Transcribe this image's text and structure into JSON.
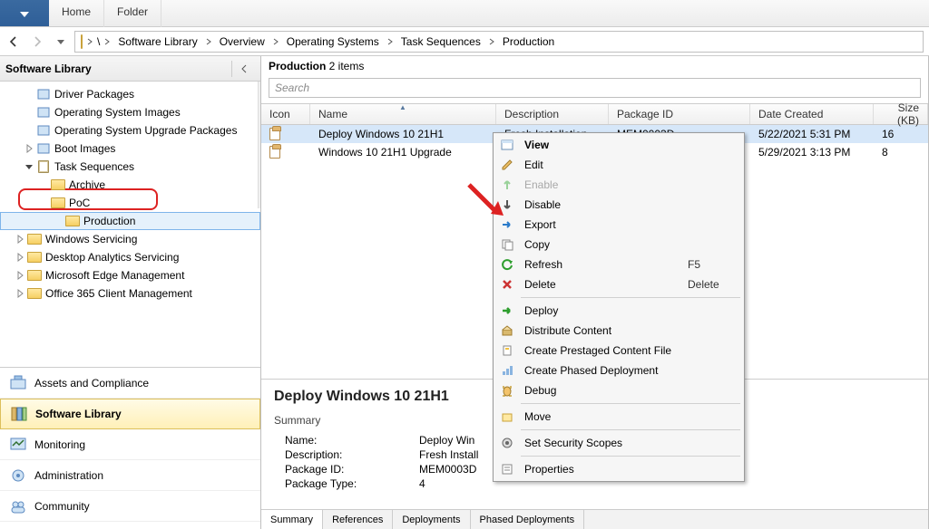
{
  "ribbon": {
    "tabs": [
      "Home",
      "Folder"
    ]
  },
  "breadcrumb": {
    "items": [
      "Software Library",
      "Overview",
      "Operating Systems",
      "Task Sequences",
      "Production"
    ]
  },
  "sidebar": {
    "title": "Software Library",
    "nodes": [
      {
        "label": "Driver Packages",
        "icon": "driver-pkg-icon",
        "indent": 0,
        "exp": ""
      },
      {
        "label": "Operating System Images",
        "icon": "os-image-icon",
        "indent": 0,
        "exp": ""
      },
      {
        "label": "Operating System Upgrade Packages",
        "icon": "os-upg-pkg-icon",
        "indent": 0,
        "exp": ""
      },
      {
        "label": "Boot Images",
        "icon": "boot-image-icon",
        "indent": 0,
        "exp": "closed"
      },
      {
        "label": "Task Sequences",
        "icon": "task-seq-icon",
        "indent": 0,
        "exp": "open"
      },
      {
        "label": "Archive",
        "icon": "folder-icon",
        "indent": 1,
        "exp": ""
      },
      {
        "label": "PoC",
        "icon": "folder-icon",
        "indent": 1,
        "exp": ""
      },
      {
        "label": "Production",
        "icon": "folder-icon",
        "indent": 1,
        "exp": "",
        "selected": true
      },
      {
        "label": "Windows Servicing",
        "icon": "folder-icon",
        "indent": 0,
        "exp": "closed",
        "root": true
      },
      {
        "label": "Desktop Analytics Servicing",
        "icon": "folder-icon",
        "indent": 0,
        "exp": "closed",
        "root": true
      },
      {
        "label": "Microsoft Edge Management",
        "icon": "folder-icon",
        "indent": 0,
        "exp": "closed",
        "root": true
      },
      {
        "label": "Office 365 Client Management",
        "icon": "folder-icon",
        "indent": 0,
        "exp": "closed",
        "root": true
      }
    ],
    "workspaces": [
      {
        "label": "Assets and Compliance",
        "icon": "assets-icon"
      },
      {
        "label": "Software Library",
        "icon": "library-icon",
        "selected": true,
        "bold": true
      },
      {
        "label": "Monitoring",
        "icon": "monitoring-icon"
      },
      {
        "label": "Administration",
        "icon": "admin-icon"
      },
      {
        "label": "Community",
        "icon": "community-icon"
      }
    ]
  },
  "results": {
    "title_prefix": "Production",
    "count_suffix": "2 items",
    "search_placeholder": "Search",
    "columns": [
      "Icon",
      "Name",
      "Description",
      "Package ID",
      "Date Created",
      "Size (KB)"
    ],
    "rows": [
      {
        "name": "Deploy Windows 10 21H1",
        "desc": "Fresh Installation ...",
        "pkg": "MEM0003D",
        "date": "5/22/2021 5:31 PM",
        "size": "16",
        "selected": true
      },
      {
        "name": "Windows 10 21H1 Upgrade",
        "desc": "",
        "pkg": "",
        "date": "5/29/2021 3:13 PM",
        "size": "8"
      }
    ]
  },
  "detail": {
    "title": "Deploy Windows 10 21H1",
    "section": "Summary",
    "fields": [
      {
        "k": "Name:",
        "v": "Deploy Win"
      },
      {
        "k": "Description:",
        "v": "Fresh Install"
      },
      {
        "k": "Package ID:",
        "v": "MEM0003D"
      },
      {
        "k": "Package Type:",
        "v": "4"
      }
    ],
    "tabs": [
      "Summary",
      "References",
      "Deployments",
      "Phased Deployments"
    ]
  },
  "context_menu": {
    "items": [
      {
        "label": "View",
        "icon": "view-icon",
        "bold": true
      },
      {
        "label": "Edit",
        "icon": "edit-icon"
      },
      {
        "label": "Enable",
        "icon": "enable-icon",
        "disabled": true
      },
      {
        "label": "Disable",
        "icon": "disable-icon"
      },
      {
        "label": "Export",
        "icon": "export-icon"
      },
      {
        "label": "Copy",
        "icon": "copy-icon"
      },
      {
        "label": "Refresh",
        "icon": "refresh-icon",
        "shortcut": "F5"
      },
      {
        "label": "Delete",
        "icon": "delete-icon",
        "shortcut": "Delete"
      },
      {
        "sep": true
      },
      {
        "label": "Deploy",
        "icon": "deploy-icon"
      },
      {
        "label": "Distribute Content",
        "icon": "distribute-icon"
      },
      {
        "label": "Create Prestaged Content File",
        "icon": "prestage-icon"
      },
      {
        "label": "Create Phased Deployment",
        "icon": "phased-icon"
      },
      {
        "label": "Debug",
        "icon": "debug-icon"
      },
      {
        "sep": true
      },
      {
        "label": "Move",
        "icon": "move-icon"
      },
      {
        "sep": true
      },
      {
        "label": "Set Security Scopes",
        "icon": "scope-icon"
      },
      {
        "sep": true
      },
      {
        "label": "Properties",
        "icon": "props-icon"
      }
    ]
  }
}
